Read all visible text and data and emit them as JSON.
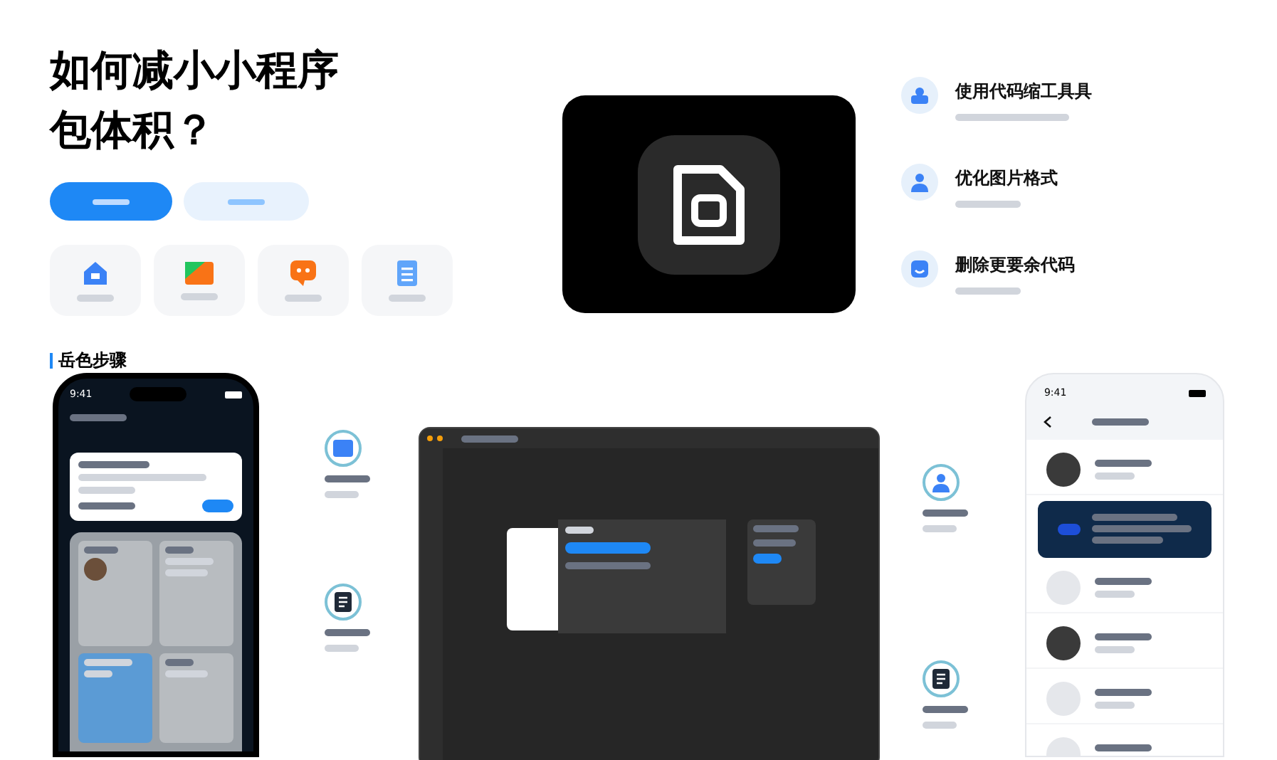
{
  "title": [
    "如何减小小程序",
    "包体积？"
  ],
  "buttons": [
    {
      "selected": true
    },
    {
      "selected": false
    }
  ],
  "tiles": [
    {
      "kind": "home",
      "color": "#3b82f6"
    },
    {
      "kind": "image",
      "color": "#f97316"
    },
    {
      "kind": "chat",
      "color": "#f97316"
    },
    {
      "kind": "doc",
      "color": "#60a5fa"
    }
  ],
  "section_heading": "岳色步骤",
  "features": [
    {
      "title": "使用代码缩工具具",
      "kind": "user"
    },
    {
      "title": "优化图片格式",
      "kind": "person"
    },
    {
      "title": "删除更要余代码",
      "kind": "face"
    }
  ],
  "left_phone": {
    "time": "9:41"
  },
  "callouts_left": [
    {
      "kind": "square"
    },
    {
      "kind": "doc"
    }
  ],
  "callouts_right": [
    {
      "kind": "person"
    },
    {
      "kind": "doc"
    }
  ],
  "right_phone": {
    "time": "9:41",
    "items": [
      {
        "kind": "photo"
      },
      {
        "kind": "banner"
      },
      {
        "kind": "blank"
      },
      {
        "kind": "photo"
      },
      {
        "kind": "blank"
      },
      {
        "kind": "blank"
      }
    ]
  }
}
